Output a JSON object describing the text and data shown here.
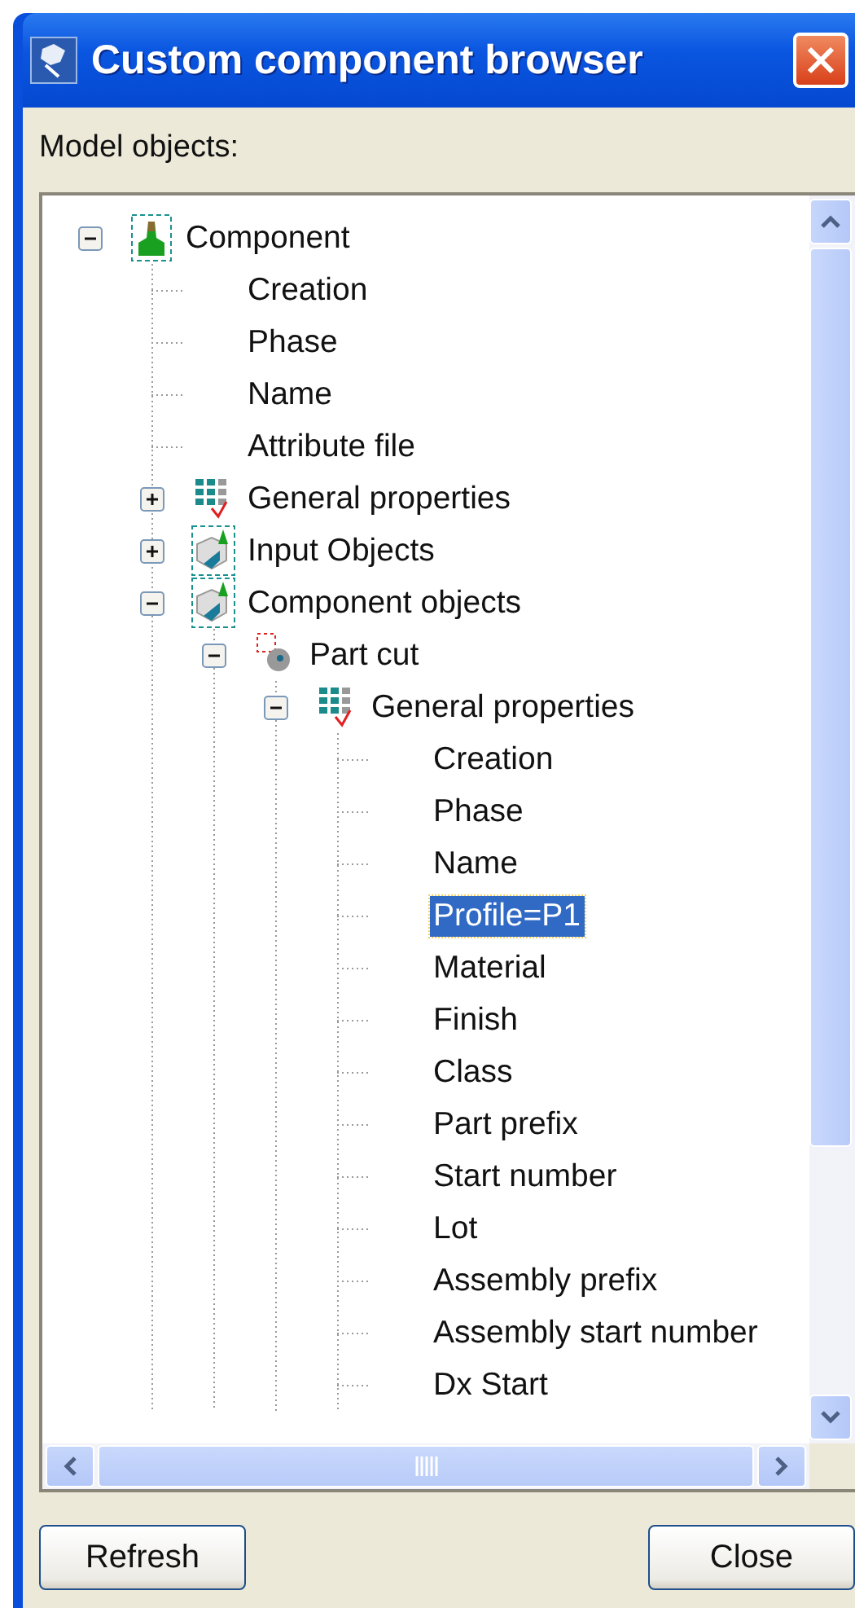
{
  "window": {
    "title": "Custom component browser"
  },
  "label": "Model objects:",
  "tree": [
    {
      "label": "Component",
      "kind": "component",
      "expanded": true,
      "selected": false,
      "children": [
        {
          "label": "Creation",
          "selected": false
        },
        {
          "label": "Phase",
          "selected": false
        },
        {
          "label": "Name",
          "selected": false
        },
        {
          "label": "Attribute file",
          "selected": false
        },
        {
          "label": "General properties",
          "kind": "properties",
          "expanded": false,
          "selected": false
        },
        {
          "label": "Input Objects",
          "kind": "objects",
          "expanded": false,
          "selected": false
        },
        {
          "label": "Component objects",
          "kind": "objects",
          "expanded": true,
          "selected": false,
          "children": [
            {
              "label": "Part cut",
              "kind": "part",
              "expanded": true,
              "selected": false,
              "children": [
                {
                  "label": "General properties",
                  "kind": "properties",
                  "expanded": true,
                  "selected": false,
                  "children": [
                    {
                      "label": "Creation",
                      "selected": false
                    },
                    {
                      "label": "Phase",
                      "selected": false
                    },
                    {
                      "label": "Name",
                      "selected": false
                    },
                    {
                      "label": "Profile=P1",
                      "selected": true
                    },
                    {
                      "label": "Material",
                      "selected": false
                    },
                    {
                      "label": "Finish",
                      "selected": false
                    },
                    {
                      "label": "Class",
                      "selected": false
                    },
                    {
                      "label": "Part prefix",
                      "selected": false
                    },
                    {
                      "label": "Start number",
                      "selected": false
                    },
                    {
                      "label": "Lot",
                      "selected": false
                    },
                    {
                      "label": "Assembly prefix",
                      "selected": false
                    },
                    {
                      "label": "Assembly start number",
                      "selected": false
                    },
                    {
                      "label": "Dx Start",
                      "selected": false
                    }
                  ]
                }
              ]
            }
          ]
        }
      ]
    }
  ],
  "buttons": [
    "Refresh",
    "Close"
  ]
}
